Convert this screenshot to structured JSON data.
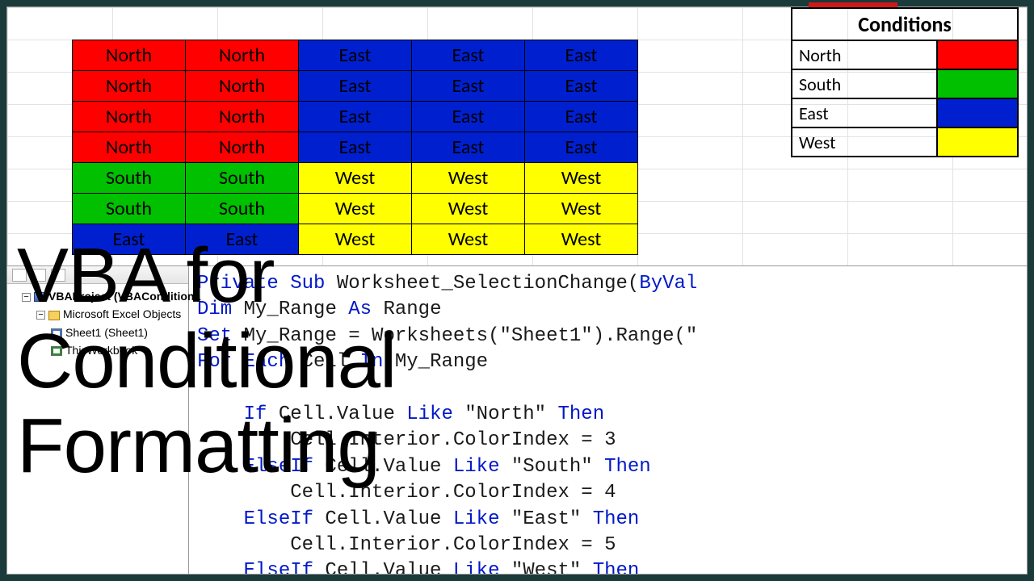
{
  "overlay": {
    "title_line1": "VBA for",
    "title_line2": "Conditional",
    "title_line3": "Formatting"
  },
  "data_grid": {
    "rows": [
      [
        "North",
        "North",
        "East",
        "East",
        "East"
      ],
      [
        "North",
        "North",
        "East",
        "East",
        "East"
      ],
      [
        "North",
        "North",
        "East",
        "East",
        "East"
      ],
      [
        "North",
        "North",
        "East",
        "East",
        "East"
      ],
      [
        "South",
        "South",
        "West",
        "West",
        "West"
      ],
      [
        "South",
        "South",
        "West",
        "West",
        "West"
      ],
      [
        "East",
        "East",
        "West",
        "West",
        "West"
      ]
    ]
  },
  "conditions": {
    "header": "Conditions",
    "items": [
      {
        "label": "North",
        "color": "#ff0000"
      },
      {
        "label": "South",
        "color": "#00c000"
      },
      {
        "label": "East",
        "color": "#0020d0"
      },
      {
        "label": "West",
        "color": "#ffff00"
      }
    ]
  },
  "vba": {
    "project_tree": {
      "root": "VBAProject (VBAConditiona",
      "folder": "Microsoft Excel Objects",
      "sheet": "Sheet1 (Sheet1)",
      "workbook": "ThisWorkbook"
    },
    "code_tokens": [
      [
        [
          "kw",
          "Private Sub"
        ],
        [
          "",
          " Worksheet_SelectionChange("
        ],
        [
          "kw",
          "ByVal"
        ]
      ],
      [
        [
          "kw",
          "Dim"
        ],
        [
          "",
          " My_Range "
        ],
        [
          "kw",
          "As"
        ],
        [
          "",
          " Range"
        ]
      ],
      [
        [
          "kw",
          "Set"
        ],
        [
          "",
          " My_Range = Worksheets(\"Sheet1\").Range(\""
        ]
      ],
      [
        [
          "kw",
          "For Each"
        ],
        [
          "",
          " Cell "
        ],
        [
          "kw",
          "In"
        ],
        [
          "",
          " My_Range"
        ]
      ],
      [
        [
          "",
          ""
        ]
      ],
      [
        [
          "",
          "    "
        ],
        [
          "kw",
          "If"
        ],
        [
          "",
          " Cell.Value "
        ],
        [
          "kw",
          "Like"
        ],
        [
          "",
          " \"North\" "
        ],
        [
          "kw",
          "Then"
        ]
      ],
      [
        [
          "",
          "        Cell.Interior.ColorIndex = 3"
        ]
      ],
      [
        [
          "",
          "    "
        ],
        [
          "kw",
          "ElseIf"
        ],
        [
          "",
          " Cell.Value "
        ],
        [
          "kw",
          "Like"
        ],
        [
          "",
          " \"South\" "
        ],
        [
          "kw",
          "Then"
        ]
      ],
      [
        [
          "",
          "        Cell.Interior.ColorIndex = 4"
        ]
      ],
      [
        [
          "",
          "    "
        ],
        [
          "kw",
          "ElseIf"
        ],
        [
          "",
          " Cell.Value "
        ],
        [
          "kw",
          "Like"
        ],
        [
          "",
          " \"East\" "
        ],
        [
          "kw",
          "Then"
        ]
      ],
      [
        [
          "",
          "        Cell.Interior.ColorIndex = 5"
        ]
      ],
      [
        [
          "",
          "    "
        ],
        [
          "kw",
          "ElseIf"
        ],
        [
          "",
          " Cell.Value "
        ],
        [
          "kw",
          "Like"
        ],
        [
          "",
          " \"West\" "
        ],
        [
          "kw",
          "Then"
        ]
      ]
    ]
  },
  "colors_map": {
    "North": "c-north",
    "South": "c-south",
    "East": "c-east",
    "West": "c-west"
  }
}
